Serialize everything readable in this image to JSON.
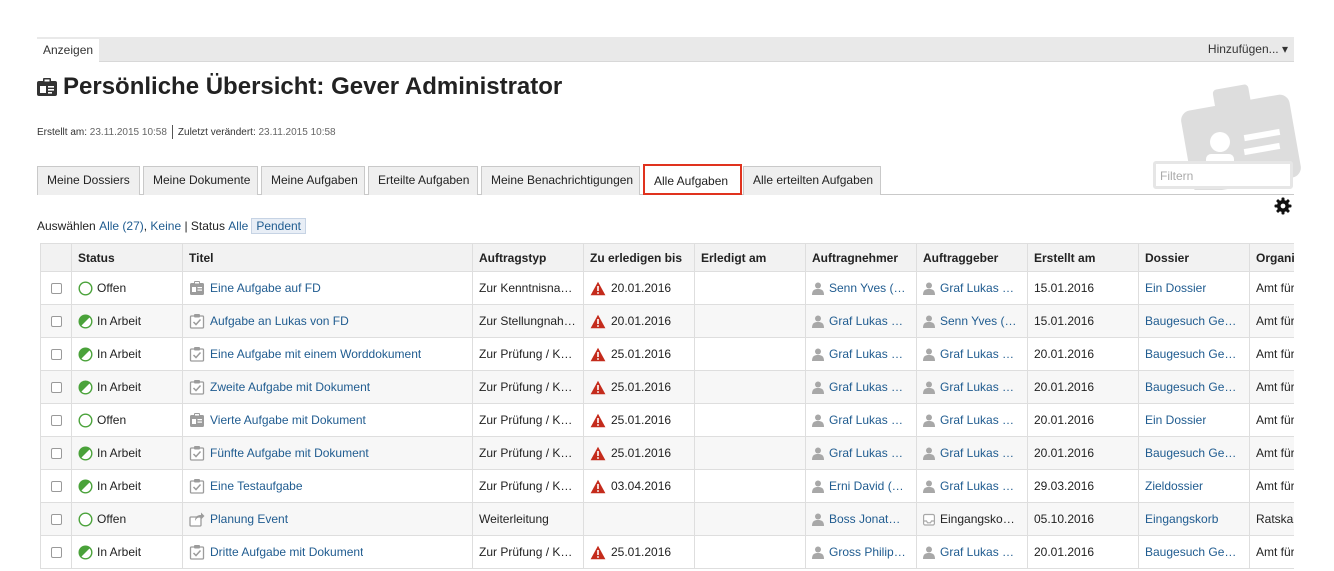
{
  "topbar": {
    "show_tab": "Anzeigen",
    "add_menu": "Hinzufügen... ▾"
  },
  "page": {
    "title": "Persönliche Übersicht: Gever Administrator",
    "created_label": "Erstellt am:",
    "created_value": "23.11.2015 10:58",
    "modified_label": "Zuletzt verändert:",
    "modified_value": "23.11.2015 10:58"
  },
  "tabs": [
    "Meine Dossiers",
    "Meine Dokumente",
    "Meine Aufgaben",
    "Erteilte Aufgaben",
    "Meine Benachrichtigungen",
    "Alle Aufgaben",
    "Alle erteilten Aufgaben"
  ],
  "filter": {
    "placeholder": "Filtern"
  },
  "selectbar": {
    "select_label": "Auswählen",
    "all": "Alle (27)",
    "none": "Keine",
    "status_label": "| Status",
    "status_all": "Alle",
    "status_pending": "Pendent"
  },
  "columns": [
    "Status",
    "Titel",
    "Auftragstyp",
    "Zu erledigen bis",
    "Erledigt am",
    "Auftragnehmer",
    "Auftraggeber",
    "Erstellt am",
    "Dossier",
    "Organi"
  ],
  "rows": [
    {
      "status": "Offen",
      "state": "open",
      "type_icon": "clipboard-icon",
      "title": "Eine Aufgabe auf FD",
      "task_type": "Zur Kenntnisna…",
      "due": "20.01.2016",
      "overdue": true,
      "done": "",
      "assignee": "Senn Yves (…",
      "issuer": "Graf Lukas …",
      "issuer_icon": "user-icon",
      "created": "15.01.2016",
      "dossier": "Ein Dossier",
      "org": "Amt für"
    },
    {
      "status": "In Arbeit",
      "state": "progress",
      "type_icon": "task-icon",
      "title": "Aufgabe an Lukas von FD",
      "task_type": "Zur Stellungnah…",
      "due": "20.01.2016",
      "overdue": true,
      "done": "",
      "assignee": "Graf Lukas …",
      "issuer": "Senn Yves (…",
      "issuer_icon": "user-icon",
      "created": "15.01.2016",
      "dossier": "Baugesuch Ge…",
      "org": "Amt für"
    },
    {
      "status": "In Arbeit",
      "state": "progress",
      "type_icon": "task-icon",
      "title": "Eine Aufgabe mit einem Worddokument",
      "task_type": "Zur Prüfung / K…",
      "due": "25.01.2016",
      "overdue": true,
      "done": "",
      "assignee": "Graf Lukas …",
      "issuer": "Graf Lukas …",
      "issuer_icon": "user-icon",
      "created": "20.01.2016",
      "dossier": "Baugesuch Ge…",
      "org": "Amt für"
    },
    {
      "status": "In Arbeit",
      "state": "progress",
      "type_icon": "task-icon",
      "title": "Zweite Aufgabe mit Dokument",
      "task_type": "Zur Prüfung / K…",
      "due": "25.01.2016",
      "overdue": true,
      "done": "",
      "assignee": "Graf Lukas …",
      "issuer": "Graf Lukas …",
      "issuer_icon": "user-icon",
      "created": "20.01.2016",
      "dossier": "Baugesuch Ge…",
      "org": "Amt für"
    },
    {
      "status": "Offen",
      "state": "open",
      "type_icon": "clipboard-icon",
      "title": "Vierte Aufgabe mit Dokument",
      "task_type": "Zur Prüfung / K…",
      "due": "25.01.2016",
      "overdue": true,
      "done": "",
      "assignee": "Graf Lukas …",
      "issuer": "Graf Lukas …",
      "issuer_icon": "user-icon",
      "created": "20.01.2016",
      "dossier": "Ein Dossier",
      "org": "Amt für"
    },
    {
      "status": "In Arbeit",
      "state": "progress",
      "type_icon": "task-icon",
      "title": "Fünfte Aufgabe mit Dokument",
      "task_type": "Zur Prüfung / K…",
      "due": "25.01.2016",
      "overdue": true,
      "done": "",
      "assignee": "Graf Lukas …",
      "issuer": "Graf Lukas …",
      "issuer_icon": "user-icon",
      "created": "20.01.2016",
      "dossier": "Baugesuch Ge…",
      "org": "Amt für"
    },
    {
      "status": "In Arbeit",
      "state": "progress",
      "type_icon": "task-icon",
      "title": "Eine Testaufgabe",
      "task_type": "Zur Prüfung / K…",
      "due": "03.04.2016",
      "overdue": true,
      "done": "",
      "assignee": "Erni David (…",
      "issuer": "Graf Lukas …",
      "issuer_icon": "user-icon",
      "created": "29.03.2016",
      "dossier": "Zieldossier",
      "org": "Amt für"
    },
    {
      "status": "Offen",
      "state": "open",
      "type_icon": "forward-icon",
      "title": "Planung Event",
      "task_type": "Weiterleitung",
      "due": "",
      "overdue": false,
      "done": "",
      "assignee": "Boss Jonat…",
      "issuer": "Eingangsko…",
      "issuer_icon": "inbox-icon",
      "created": "05.10.2016",
      "dossier": "Eingangskorb",
      "org": "Ratska"
    },
    {
      "status": "In Arbeit",
      "state": "progress",
      "type_icon": "task-icon",
      "title": "Dritte Aufgabe mit Dokument",
      "task_type": "Zur Prüfung / K…",
      "due": "25.01.2016",
      "overdue": true,
      "done": "",
      "assignee": "Gross Philip…",
      "issuer": "Graf Lukas …",
      "issuer_icon": "user-icon",
      "created": "20.01.2016",
      "dossier": "Baugesuch Ge…",
      "org": "Amt für"
    }
  ]
}
